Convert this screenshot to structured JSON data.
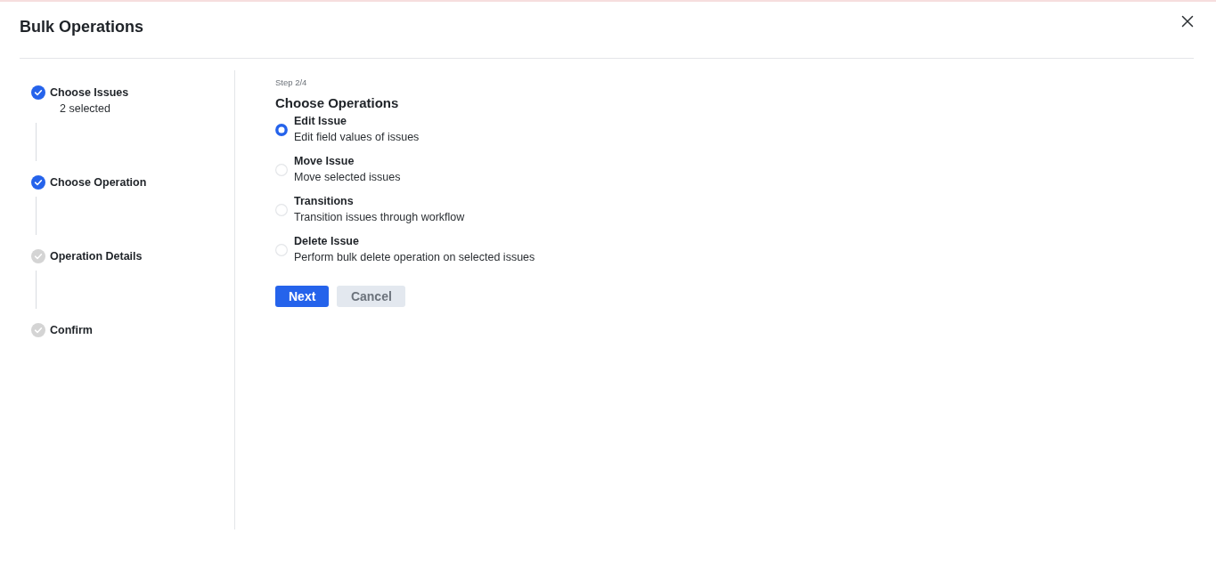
{
  "dialog": {
    "title": "Bulk Operations"
  },
  "steps": [
    {
      "label": "Choose Issues",
      "note": "2 selected",
      "completed": true
    },
    {
      "label": "Choose Operation",
      "completed": true
    },
    {
      "label": "Operation Details",
      "completed": false
    },
    {
      "label": "Confirm",
      "completed": false
    }
  ],
  "content": {
    "step_indicator": "Step 2/4",
    "heading": "Choose Operations",
    "options": [
      {
        "title": "Edit Issue",
        "description": "Edit field values of issues",
        "selected": true
      },
      {
        "title": "Move Issue",
        "description": "Move selected issues",
        "selected": false
      },
      {
        "title": "Transitions",
        "description": "Transition issues through workflow",
        "selected": false
      },
      {
        "title": "Delete Issue",
        "description": "Perform bulk delete operation on selected issues",
        "selected": false
      }
    ],
    "buttons": [
      {
        "label": "Next",
        "kind": "primary"
      },
      {
        "label": "Cancel",
        "kind": "secondary"
      }
    ]
  }
}
